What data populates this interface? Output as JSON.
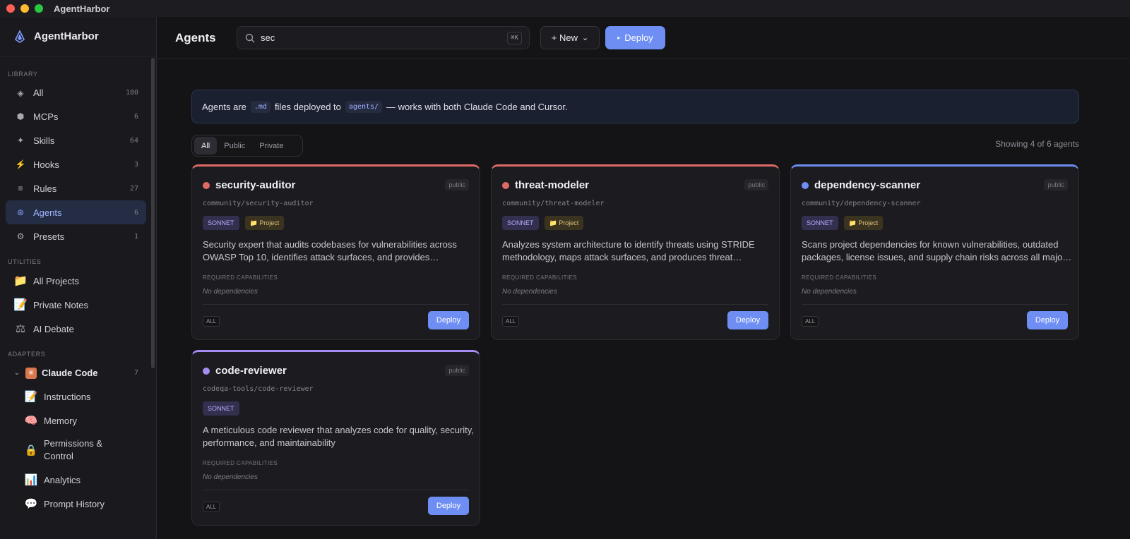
{
  "window": {
    "title": "AgentHarbor"
  },
  "colors": {
    "accent": "#6f8ef3",
    "close": "#fe5f57",
    "minimize": "#febc2e",
    "zoom": "#28c840"
  },
  "sidebar": {
    "brand": "AgentHarbor",
    "sections": {
      "library": "LIBRARY",
      "utilities": "UTILITIES",
      "adapters": "ADAPTERS"
    },
    "library": [
      {
        "label": "All",
        "count": "180",
        "icon": "diamond-icon",
        "glyph": "◈"
      },
      {
        "label": "MCPs",
        "count": "6",
        "icon": "mcp-icon",
        "glyph": "⬢"
      },
      {
        "label": "Skills",
        "count": "64",
        "icon": "sparkle-icon",
        "glyph": "✦"
      },
      {
        "label": "Hooks",
        "count": "3",
        "icon": "lightning-icon",
        "glyph": "⚡"
      },
      {
        "label": "Rules",
        "count": "27",
        "icon": "lines-icon",
        "glyph": "≡"
      },
      {
        "label": "Agents",
        "count": "6",
        "icon": "agent-icon",
        "glyph": "⊛"
      },
      {
        "label": "Presets",
        "count": "1",
        "icon": "preset-icon",
        "glyph": "⚙"
      }
    ],
    "utilities": [
      {
        "label": "All Projects",
        "icon": "folder-icon",
        "glyph": "📁"
      },
      {
        "label": "Private Notes",
        "icon": "memo-icon",
        "glyph": "📝"
      },
      {
        "label": "AI Debate",
        "icon": "scales-icon",
        "glyph": "⚖"
      }
    ],
    "adapter": {
      "label": "Claude Code",
      "count": "7",
      "icon": "claude-icon",
      "glyph": "✳"
    },
    "adapter_items": [
      {
        "label": "Instructions",
        "icon": "memo-icon",
        "glyph": "📝"
      },
      {
        "label": "Memory",
        "icon": "brain-icon",
        "glyph": "🧠"
      },
      {
        "label": "Permissions &",
        "label2": "Control",
        "icon": "lock-icon",
        "glyph": "🔒"
      },
      {
        "label": "Analytics",
        "icon": "chart-icon",
        "glyph": "📊"
      },
      {
        "label": "Prompt History",
        "icon": "speech-bubble-icon",
        "glyph": "💬"
      }
    ]
  },
  "header": {
    "title": "Agents",
    "search_value": "sec",
    "search_shortcut": "⌘K",
    "new_label": "+ New",
    "deploy_label": "Deploy"
  },
  "banner": {
    "part1": "Agents are",
    "code1": ".md",
    "part2": "files deployed to",
    "code2": "agents/",
    "part3": "— works with both Claude Code and Cursor."
  },
  "filters": [
    "All",
    "Public",
    "Private"
  ],
  "showing": "Showing 4 of 6 agents",
  "cards": [
    {
      "name": "security-auditor",
      "visibility": "public",
      "path": "community/security-auditor",
      "model": "SONNET",
      "project": "📁 Project",
      "description": "Security expert that audits codebases for vulnerabilities across OWASP Top 10, identifies attack surfaces, and provides…",
      "cap_label": "REQUIRED CAPABILITIES",
      "cap_value": "No dependencies",
      "scope": "ALL",
      "deploy": "Deploy",
      "color": "#e06b66"
    },
    {
      "name": "threat-modeler",
      "visibility": "public",
      "path": "community/threat-modeler",
      "model": "SONNET",
      "project": "📁 Project",
      "description": "Analyzes system architecture to identify threats using STRIDE methodology, maps attack surfaces, and produces threat…",
      "cap_label": "REQUIRED CAPABILITIES",
      "cap_value": "No dependencies",
      "scope": "ALL",
      "deploy": "Deploy",
      "color": "#e06b66"
    },
    {
      "name": "dependency-scanner",
      "visibility": "public",
      "path": "community/dependency-scanner",
      "model": "SONNET",
      "project": "📁 Project",
      "description": "Scans project dependencies for known vulnerabilities, outdated packages, license issues, and supply chain risks across all majo…",
      "cap_label": "REQUIRED CAPABILITIES",
      "cap_value": "No dependencies",
      "scope": "ALL",
      "deploy": "Deploy",
      "color": "#6f8ef3"
    },
    {
      "name": "code-reviewer",
      "visibility": "public",
      "path": "codeqa-tools/code-reviewer",
      "model": "SONNET",
      "description": "A meticulous code reviewer that analyzes code for quality, security, performance, and maintainability",
      "cap_label": "REQUIRED CAPABILITIES",
      "cap_value": "No dependencies",
      "scope": "ALL",
      "deploy": "Deploy",
      "color": "#a48cf0"
    }
  ]
}
